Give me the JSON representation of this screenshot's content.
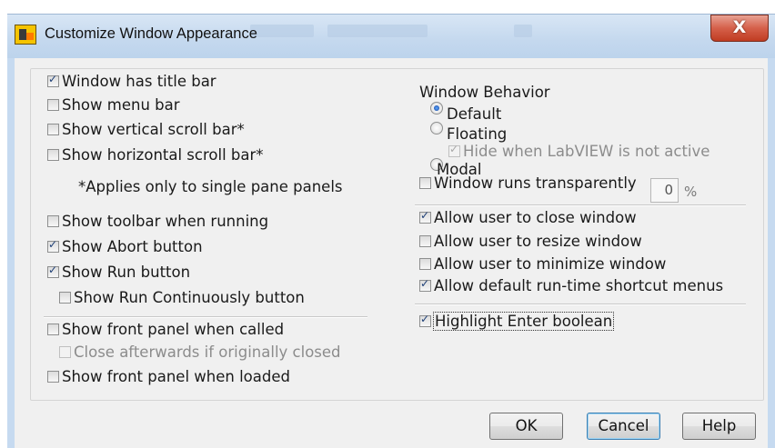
{
  "window": {
    "title": "Customize Window Appearance",
    "close_glyph": "X"
  },
  "left": {
    "title_bar": {
      "label": "Window has title bar",
      "checked": true
    },
    "menu_bar": {
      "label": "Show menu bar",
      "checked": false
    },
    "vscroll": {
      "label": "Show vertical scroll bar*",
      "checked": false
    },
    "hscroll": {
      "label": "Show horizontal scroll bar*",
      "checked": false
    },
    "note": "*Applies only to single pane panels",
    "toolbar": {
      "label": "Show toolbar when running",
      "checked": false
    },
    "abort": {
      "label": "Show Abort button",
      "checked": true
    },
    "run": {
      "label": "Show Run button",
      "checked": true
    },
    "run_cont": {
      "label": "Show Run Continuously button",
      "checked": false
    },
    "fp_called": {
      "label": "Show front panel when called",
      "checked": false
    },
    "close_after": {
      "label": "Close afterwards if originally closed",
      "checked": false,
      "disabled": true
    },
    "fp_loaded": {
      "label": "Show front panel when loaded",
      "checked": false
    }
  },
  "right": {
    "behavior_label": "Window Behavior",
    "radio_default": {
      "label": "Default",
      "selected": true
    },
    "radio_floating": {
      "label": "Floating",
      "selected": false
    },
    "hide_inactive": {
      "label": "Hide when LabVIEW is not active",
      "checked": true,
      "disabled": true
    },
    "radio_modal": {
      "label": "Modal",
      "selected": false
    },
    "transparent": {
      "label": "Window runs transparently",
      "checked": false
    },
    "transparency_value": "0",
    "transparency_unit": "%",
    "allow_close": {
      "label": "Allow user to close window",
      "checked": true
    },
    "allow_resize": {
      "label": "Allow user to resize window",
      "checked": false
    },
    "allow_minimize": {
      "label": "Allow user to minimize window",
      "checked": false
    },
    "allow_shortcut": {
      "label": "Allow default run-time shortcut menus",
      "checked": true
    },
    "highlight_enter": {
      "label": "Highlight Enter boolean",
      "checked": true
    }
  },
  "buttons": {
    "ok": "OK",
    "cancel": "Cancel",
    "help": "Help"
  },
  "colors": {
    "titlebar": "#c4d8ee",
    "close_button": "#d5604a",
    "dialog_bg": "#f0f0f0",
    "check_mark": "#1e3f77"
  }
}
